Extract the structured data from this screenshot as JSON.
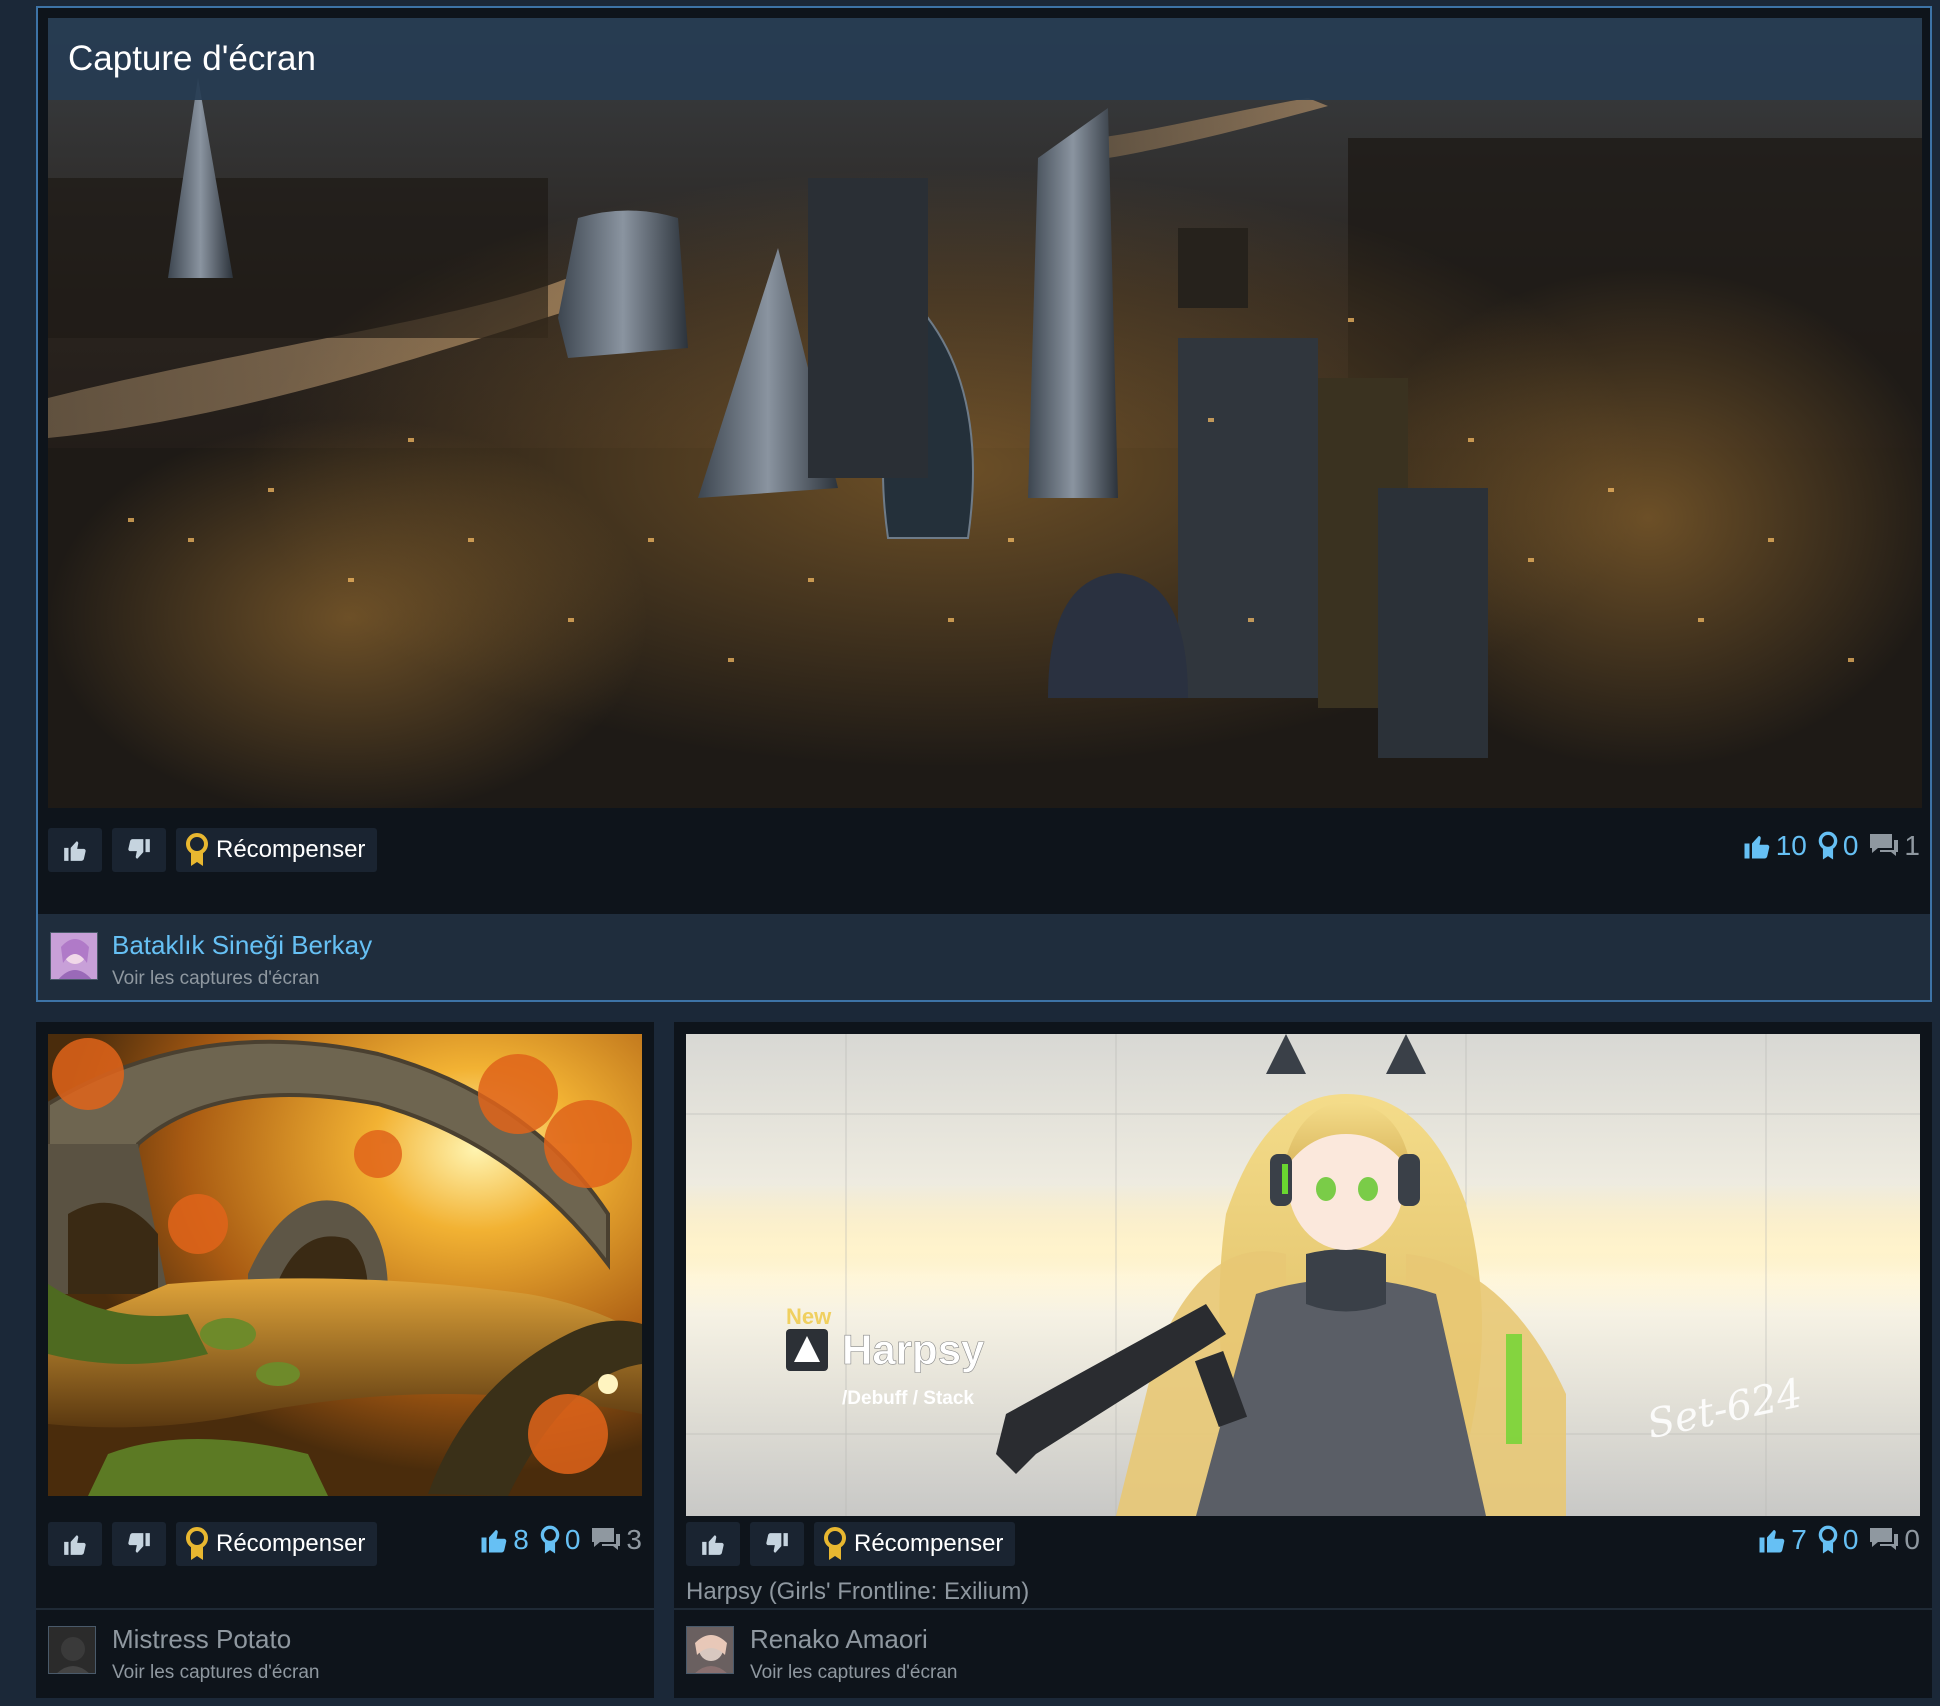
{
  "featured": {
    "title": "Capture d'écran",
    "award_label": "Récompenser",
    "stats": {
      "likes": "10",
      "awards": "0",
      "comments": "1"
    },
    "author": {
      "name": "Bataklık Sineği Berkay",
      "sub": "Voir les captures d'écran"
    }
  },
  "card_left": {
    "award_label": "Récompenser",
    "stats": {
      "likes": "8",
      "awards": "0",
      "comments": "3"
    },
    "author": {
      "name": "Mistress Potato",
      "sub": "Voir les captures d'écran"
    }
  },
  "card_right": {
    "award_label": "Récompenser",
    "stats": {
      "likes": "7",
      "awards": "0",
      "comments": "0"
    },
    "caption": "Harpsy (Girls' Frontline: Exilium)",
    "image_text": {
      "badge": "New",
      "name": "Harpsy",
      "sub": "/Debuff / Stack",
      "signature": "Set-624"
    },
    "author": {
      "name": "Renako Amaori",
      "sub": "Voir les captures d'écran"
    }
  },
  "colors": {
    "accent": "#66c0f4",
    "featured_border": "#3d73a6",
    "award_gold": "#e8b730",
    "card_bg": "#0e141b",
    "page_bg": "#1b2838"
  },
  "icons": [
    "thumbs-up-icon",
    "thumbs-down-icon",
    "award-icon",
    "comment-icon"
  ]
}
